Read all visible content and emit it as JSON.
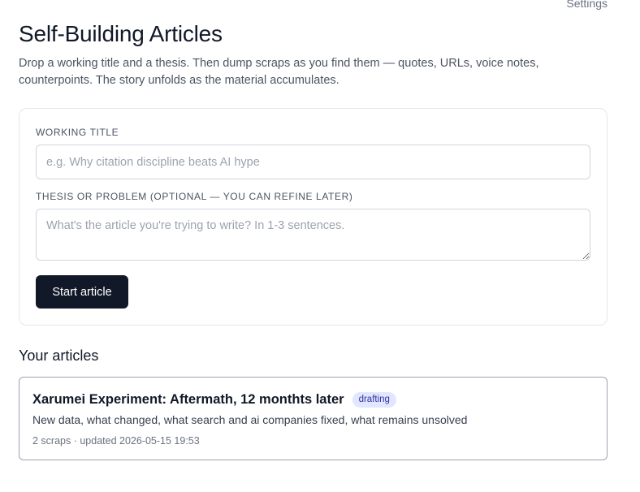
{
  "header": {
    "settings_label": "Settings",
    "title": "Self-Building Articles",
    "subtitle": "Drop a working title and a thesis. Then dump scraps as you find them — quotes, URLs, voice notes, counterpoints. The story unfolds as the material accumulates."
  },
  "form": {
    "title_label": "WORKING TITLE",
    "title_placeholder": "e.g. Why citation discipline beats AI hype",
    "title_value": "",
    "thesis_label": "THESIS OR PROBLEM (OPTIONAL — YOU CAN REFINE LATER)",
    "thesis_placeholder": "What's the article you're trying to write? In 1-3 sentences.",
    "thesis_value": "",
    "submit_label": "Start article"
  },
  "articles": {
    "heading": "Your articles",
    "items": [
      {
        "title": "Xarumei Experiment: Aftermath, 12 monthts later",
        "status": "drafting",
        "description": "New data, what changed, what search and ai companies fixed, what remains unsolved",
        "meta": "2 scraps · updated 2026-05-15 19:53"
      }
    ]
  },
  "colors": {
    "primary_button": "#111827",
    "badge_bg": "#e0e7ff",
    "badge_text": "#3730a3"
  }
}
